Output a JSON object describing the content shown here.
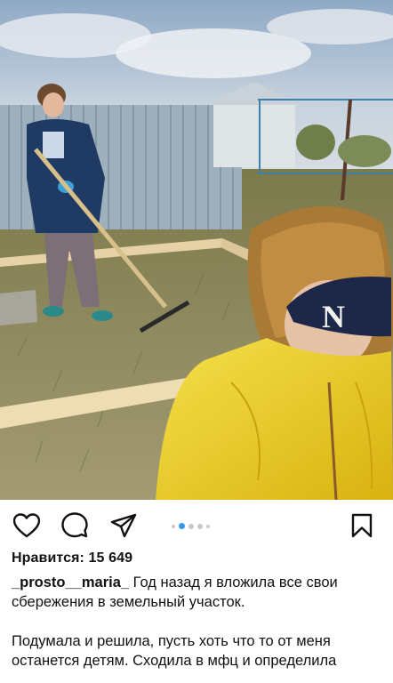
{
  "post": {
    "photo": {
      "description_icon": "photo-image",
      "colors": {
        "sky": "#aebfd0",
        "jacket_yellow": "#f2d21e",
        "coat_navy": "#1f3a63",
        "grass": "#8a8a52"
      },
      "cap_letter": "N"
    },
    "actions": {
      "like_icon": "heart-icon",
      "comment_icon": "comment-icon",
      "share_icon": "share-icon",
      "save_icon": "bookmark-icon"
    },
    "carousel": {
      "total_dots": 5,
      "active_index": 1
    },
    "likes_label": "Нравится: 15 649",
    "username": "_prosto__maria_",
    "caption_line1": " Год назад я вложила все свои сбережения в земельный участок.",
    "caption_para2": "Подумала и решила, пусть хоть что то от меня останется детям. Сходила в мфц и определила"
  }
}
